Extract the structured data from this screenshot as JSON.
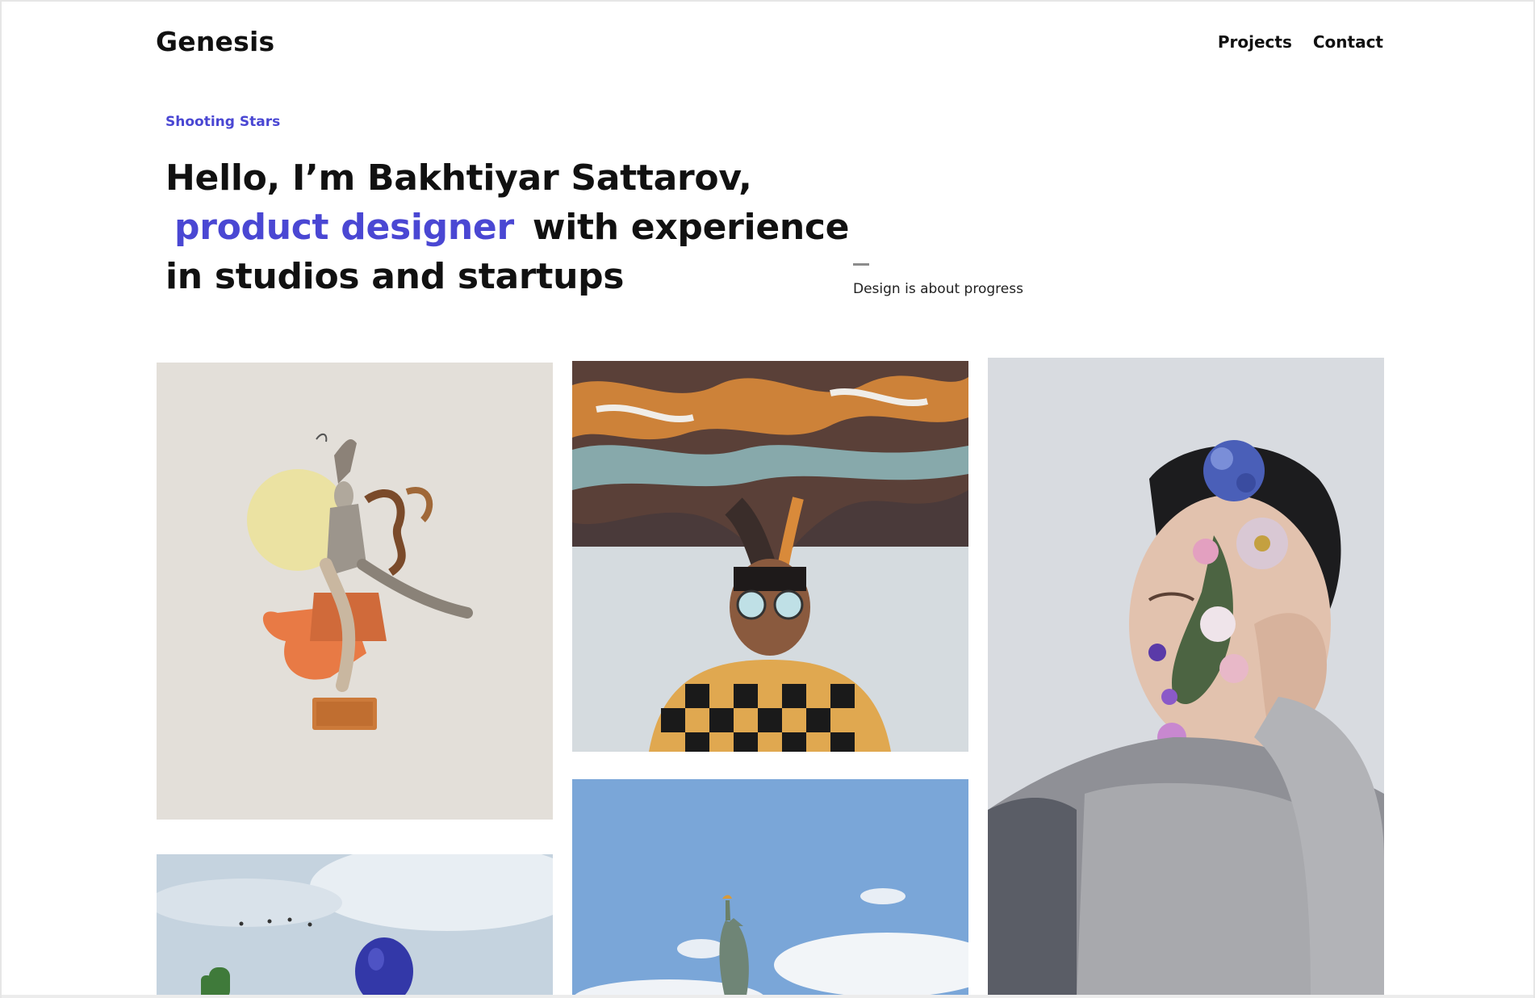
{
  "site": {
    "logo": "Genesis"
  },
  "nav": {
    "items": [
      "Projects",
      "Contact"
    ]
  },
  "hero": {
    "eyebrow": "Shooting Stars",
    "line1": "Hello, I’m Bakhtiyar Sattarov,",
    "accent": "product designer",
    "line2_rest": "with experience",
    "line3": "in studios and startups",
    "tagline": "Design is about progress"
  },
  "gallery": [
    {
      "name": "dancer-collage-photo",
      "icon": "collage-image"
    },
    {
      "name": "smoke-hair-portrait-photo",
      "icon": "portrait-image"
    },
    {
      "name": "flower-face-portrait-photo",
      "icon": "portrait-image"
    },
    {
      "name": "blue-balloon-cactus-photo",
      "icon": "landscape-image"
    },
    {
      "name": "statue-of-liberty-photo",
      "icon": "landscape-image"
    }
  ],
  "colors": {
    "accent": "#4a47d3",
    "text": "#111111",
    "background": "#ffffff"
  }
}
